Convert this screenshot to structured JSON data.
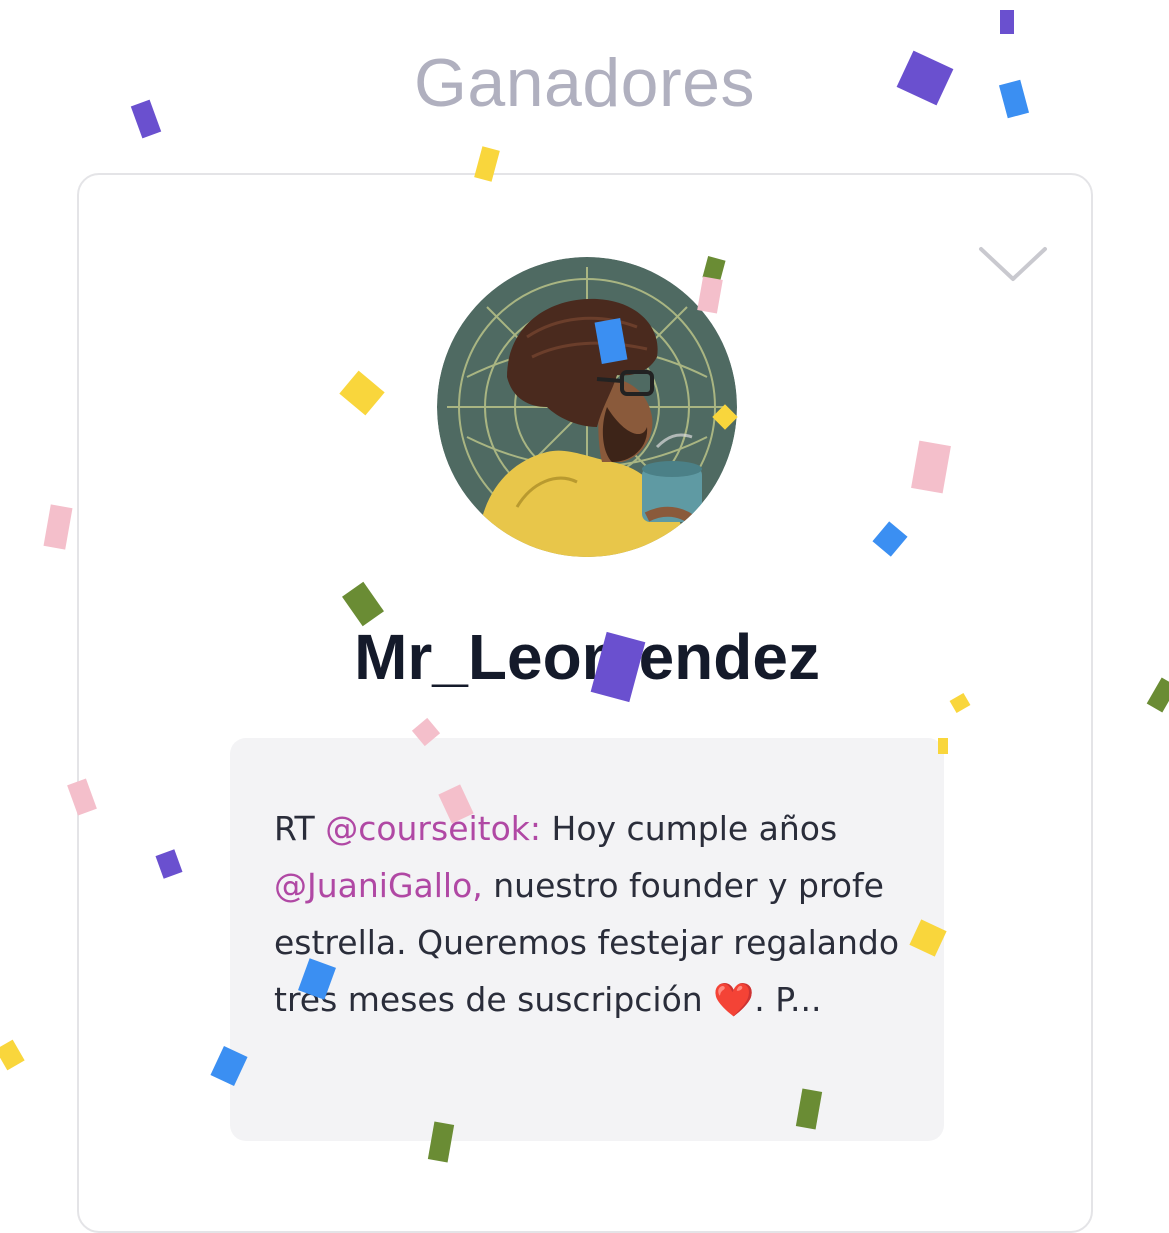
{
  "page": {
    "heading": "Ganadores"
  },
  "winner": {
    "username": "Mr_Leomendez",
    "avatar_icon": "avatar-illustration",
    "toggle_icon": "chevron-down-icon"
  },
  "tweet": {
    "rt_prefix": "RT",
    "mention_author": "@courseitok:",
    "text_1": "Hoy cumple años",
    "mention_2": "@JuaniGallo,",
    "text_2": "nuestro founder y profe estrella. Queremos festejar regalando tres meses de suscripción",
    "emoji": "❤️",
    "text_3": ". P..."
  },
  "colors": {
    "heading": "#b0b0bf",
    "name": "#141a2a",
    "mention": "#b048a4",
    "tweet_bg": "#f3f3f5",
    "card_border": "#e4e4e7"
  },
  "confetti_colors": [
    "#6a50cf",
    "#3b8ff2",
    "#f9d63c",
    "#f4bfcb",
    "#6a8c34"
  ]
}
